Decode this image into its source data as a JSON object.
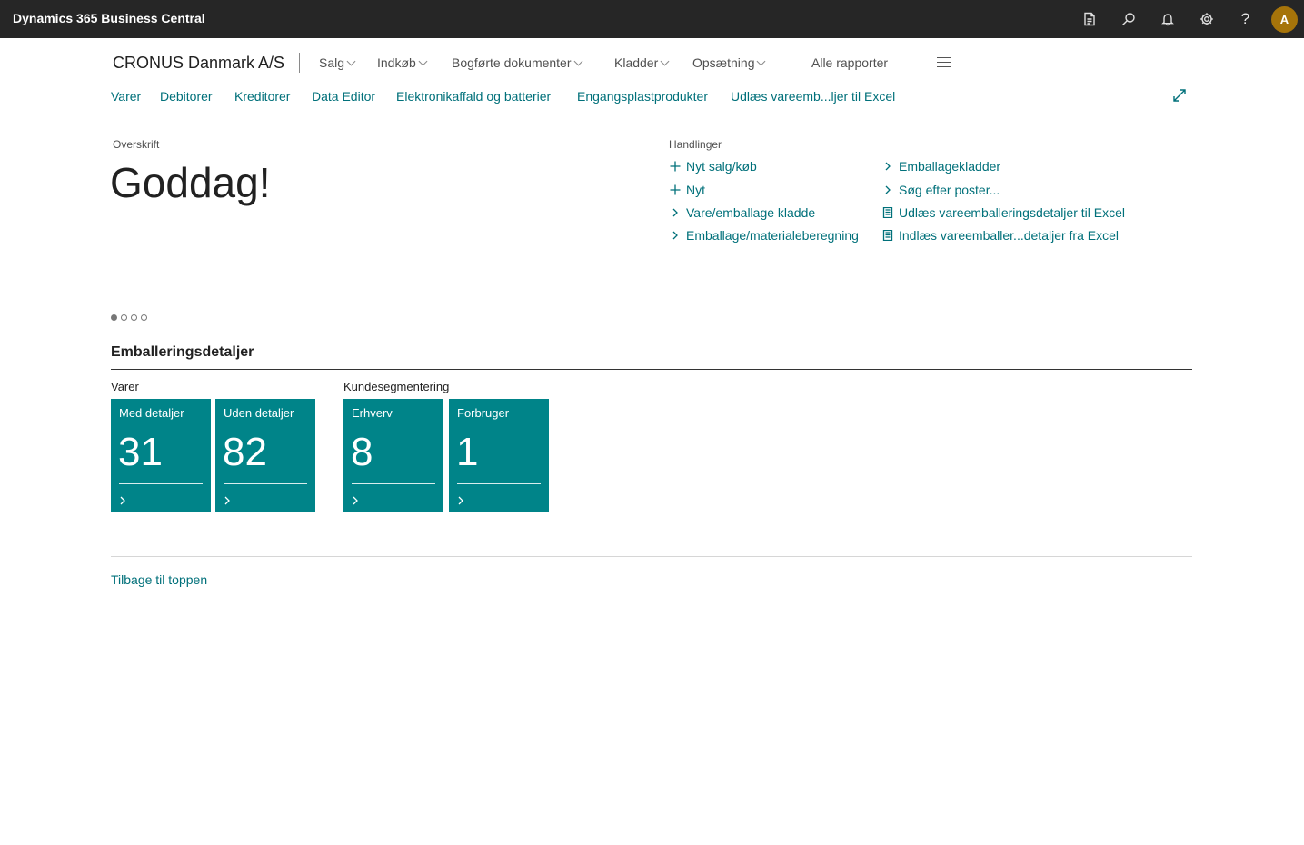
{
  "app": {
    "title": "Dynamics 365 Business Central",
    "avatar_initial": "A",
    "help_glyph": "?"
  },
  "appbar_icons": [
    "report-icon",
    "search-icon",
    "bell-icon",
    "gear-icon",
    "help-icon"
  ],
  "company": "CRONUS Danmark A/S",
  "menu": {
    "salg": "Salg",
    "indkob": "Indkøb",
    "bogforte": "Bogførte dokumenter",
    "kladder": "Kladder",
    "opsaetning": "Opsætning",
    "alle_rapporter": "Alle rapporter"
  },
  "navlinks": [
    "Varer",
    "Debitorer",
    "Kreditorer",
    "Data Editor",
    "Elektronikaffald og batterier",
    "Engangsplastprodukter",
    "Udlæs vareemb...ljer til Excel"
  ],
  "headline": {
    "caption": "Overskrift",
    "greeting": "Goddag!"
  },
  "actions": {
    "caption": "Handlinger",
    "items": [
      {
        "label": "Nyt salg/køb",
        "icon": "plus-icon"
      },
      {
        "label": "Nyt",
        "icon": "plus-icon"
      },
      {
        "label": "Vare/emballage kladde",
        "icon": "chevron-right-icon"
      },
      {
        "label": "Emballage/materialeberegning",
        "icon": "chevron-right-icon"
      },
      {
        "label": "Emballagekladder",
        "icon": "chevron-right-icon"
      },
      {
        "label": "Søg efter poster...",
        "icon": "chevron-right-icon"
      },
      {
        "label": "Udlæs vareemballeringsdetaljer til Excel",
        "icon": "document-icon"
      },
      {
        "label": "Indlæs vareemballer...detaljer fra Excel",
        "icon": "document-icon"
      }
    ]
  },
  "carousel": {
    "count": 4,
    "active": 0
  },
  "section": {
    "title": "Emballeringsdetaljer",
    "groups": [
      {
        "title": "Varer",
        "tiles": [
          {
            "label": "Med detaljer",
            "value": "31"
          },
          {
            "label": "Uden detaljer",
            "value": "82"
          }
        ]
      },
      {
        "title": "Kundesegmentering",
        "tiles": [
          {
            "label": "Erhverv",
            "value": "8"
          },
          {
            "label": "Forbruger",
            "value": "1"
          }
        ]
      }
    ]
  },
  "footer": {
    "back_to_top": "Tilbage til toppen"
  },
  "colors": {
    "appbar": "#262626",
    "link": "#00707a",
    "tile": "#008489",
    "avatar": "#a6740a"
  }
}
